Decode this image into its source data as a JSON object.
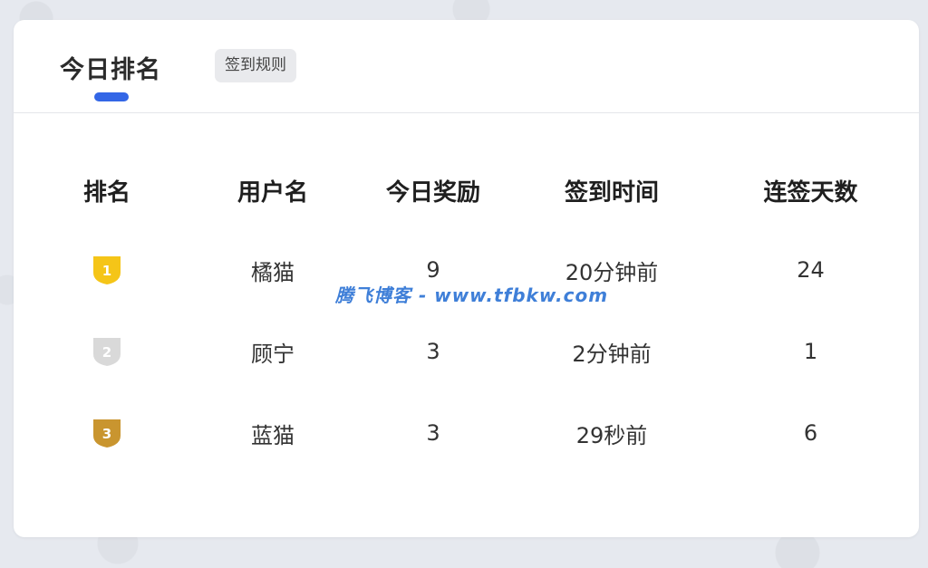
{
  "header": {
    "tab_title": "今日排名",
    "rules_label": "签到规则"
  },
  "table": {
    "columns": [
      "排名",
      "用户名",
      "今日奖励",
      "签到时间",
      "连签天数"
    ],
    "rows": [
      {
        "rank": "1",
        "username": "橘猫",
        "reward": "9",
        "time": "20分钟前",
        "streak": "24",
        "medal": "gold-medal-icon"
      },
      {
        "rank": "2",
        "username": "顾宁",
        "reward": "3",
        "time": "2分钟前",
        "streak": "1",
        "medal": "silver-medal-icon"
      },
      {
        "rank": "3",
        "username": "蓝猫",
        "reward": "3",
        "time": "29秒前",
        "streak": "6",
        "medal": "bronze-medal-icon"
      }
    ]
  },
  "watermark": "腾飞博客 - www.tfbkw.com",
  "colors": {
    "accent": "#3366e6",
    "gold": "#f5c518",
    "silver": "#d9d9d9",
    "bronze": "#c9952f"
  }
}
